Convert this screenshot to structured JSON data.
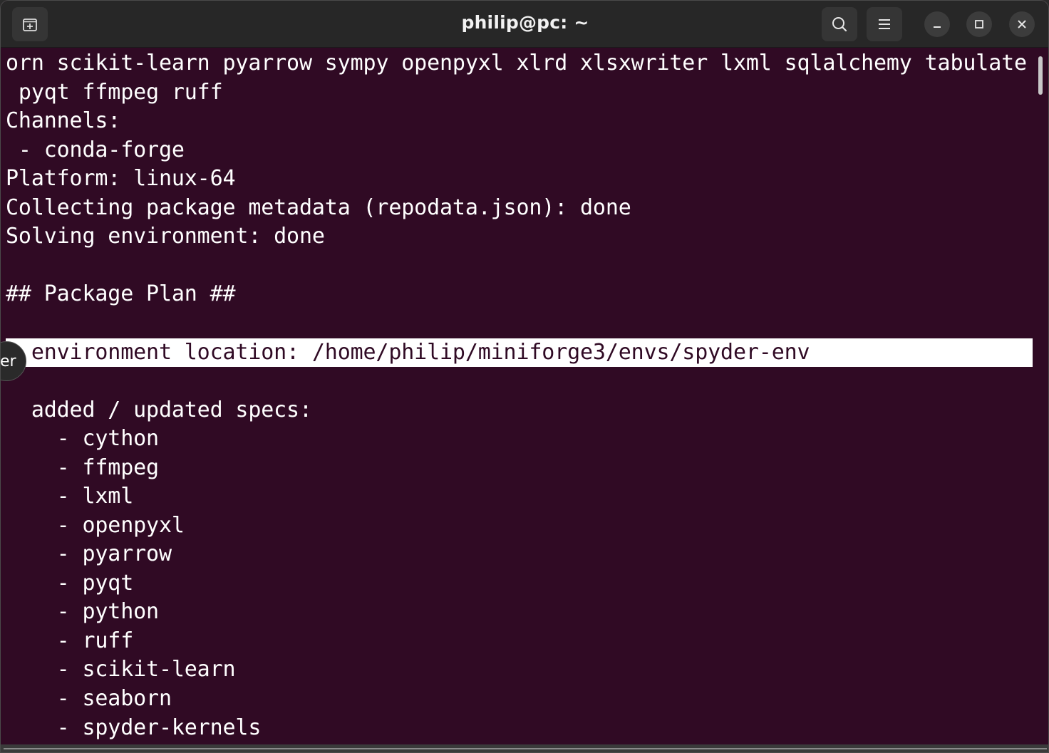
{
  "window": {
    "title": "philip@pc: ~"
  },
  "titlebar": {
    "new_tab_icon": "new-tab-icon",
    "search_icon": "search-icon",
    "menu_icon": "hamburger-menu-icon",
    "minimize_icon": "minimize-icon",
    "maximize_icon": "maximize-icon",
    "close_icon": "close-icon"
  },
  "side_tab": {
    "text": "er"
  },
  "terminal": {
    "lines": [
      "orn scikit-learn pyarrow sympy openpyxl xlrd xlsxwriter lxml sqlalchemy tabulate",
      " pyqt ffmpeg ruff",
      "Channels:",
      " - conda-forge",
      "Platform: linux-64",
      "Collecting package metadata (repodata.json): done",
      "Solving environment: done",
      "",
      "## Package Plan ##",
      "",
      "  environment location: /home/philip/miniforge3/envs/spyder-env",
      "",
      "  added / updated specs:",
      "    - cython",
      "    - ffmpeg",
      "    - lxml",
      "    - openpyxl",
      "    - pyarrow",
      "    - pyqt",
      "    - python",
      "    - ruff",
      "    - scikit-learn",
      "    - seaborn",
      "    - spyder-kernels"
    ],
    "highlighted_line": 10
  },
  "colors": {
    "terminal_background": "#300a24",
    "terminal_text": "#ffffff",
    "titlebar_background": "#272727",
    "highlight_background": "#ffffff"
  }
}
